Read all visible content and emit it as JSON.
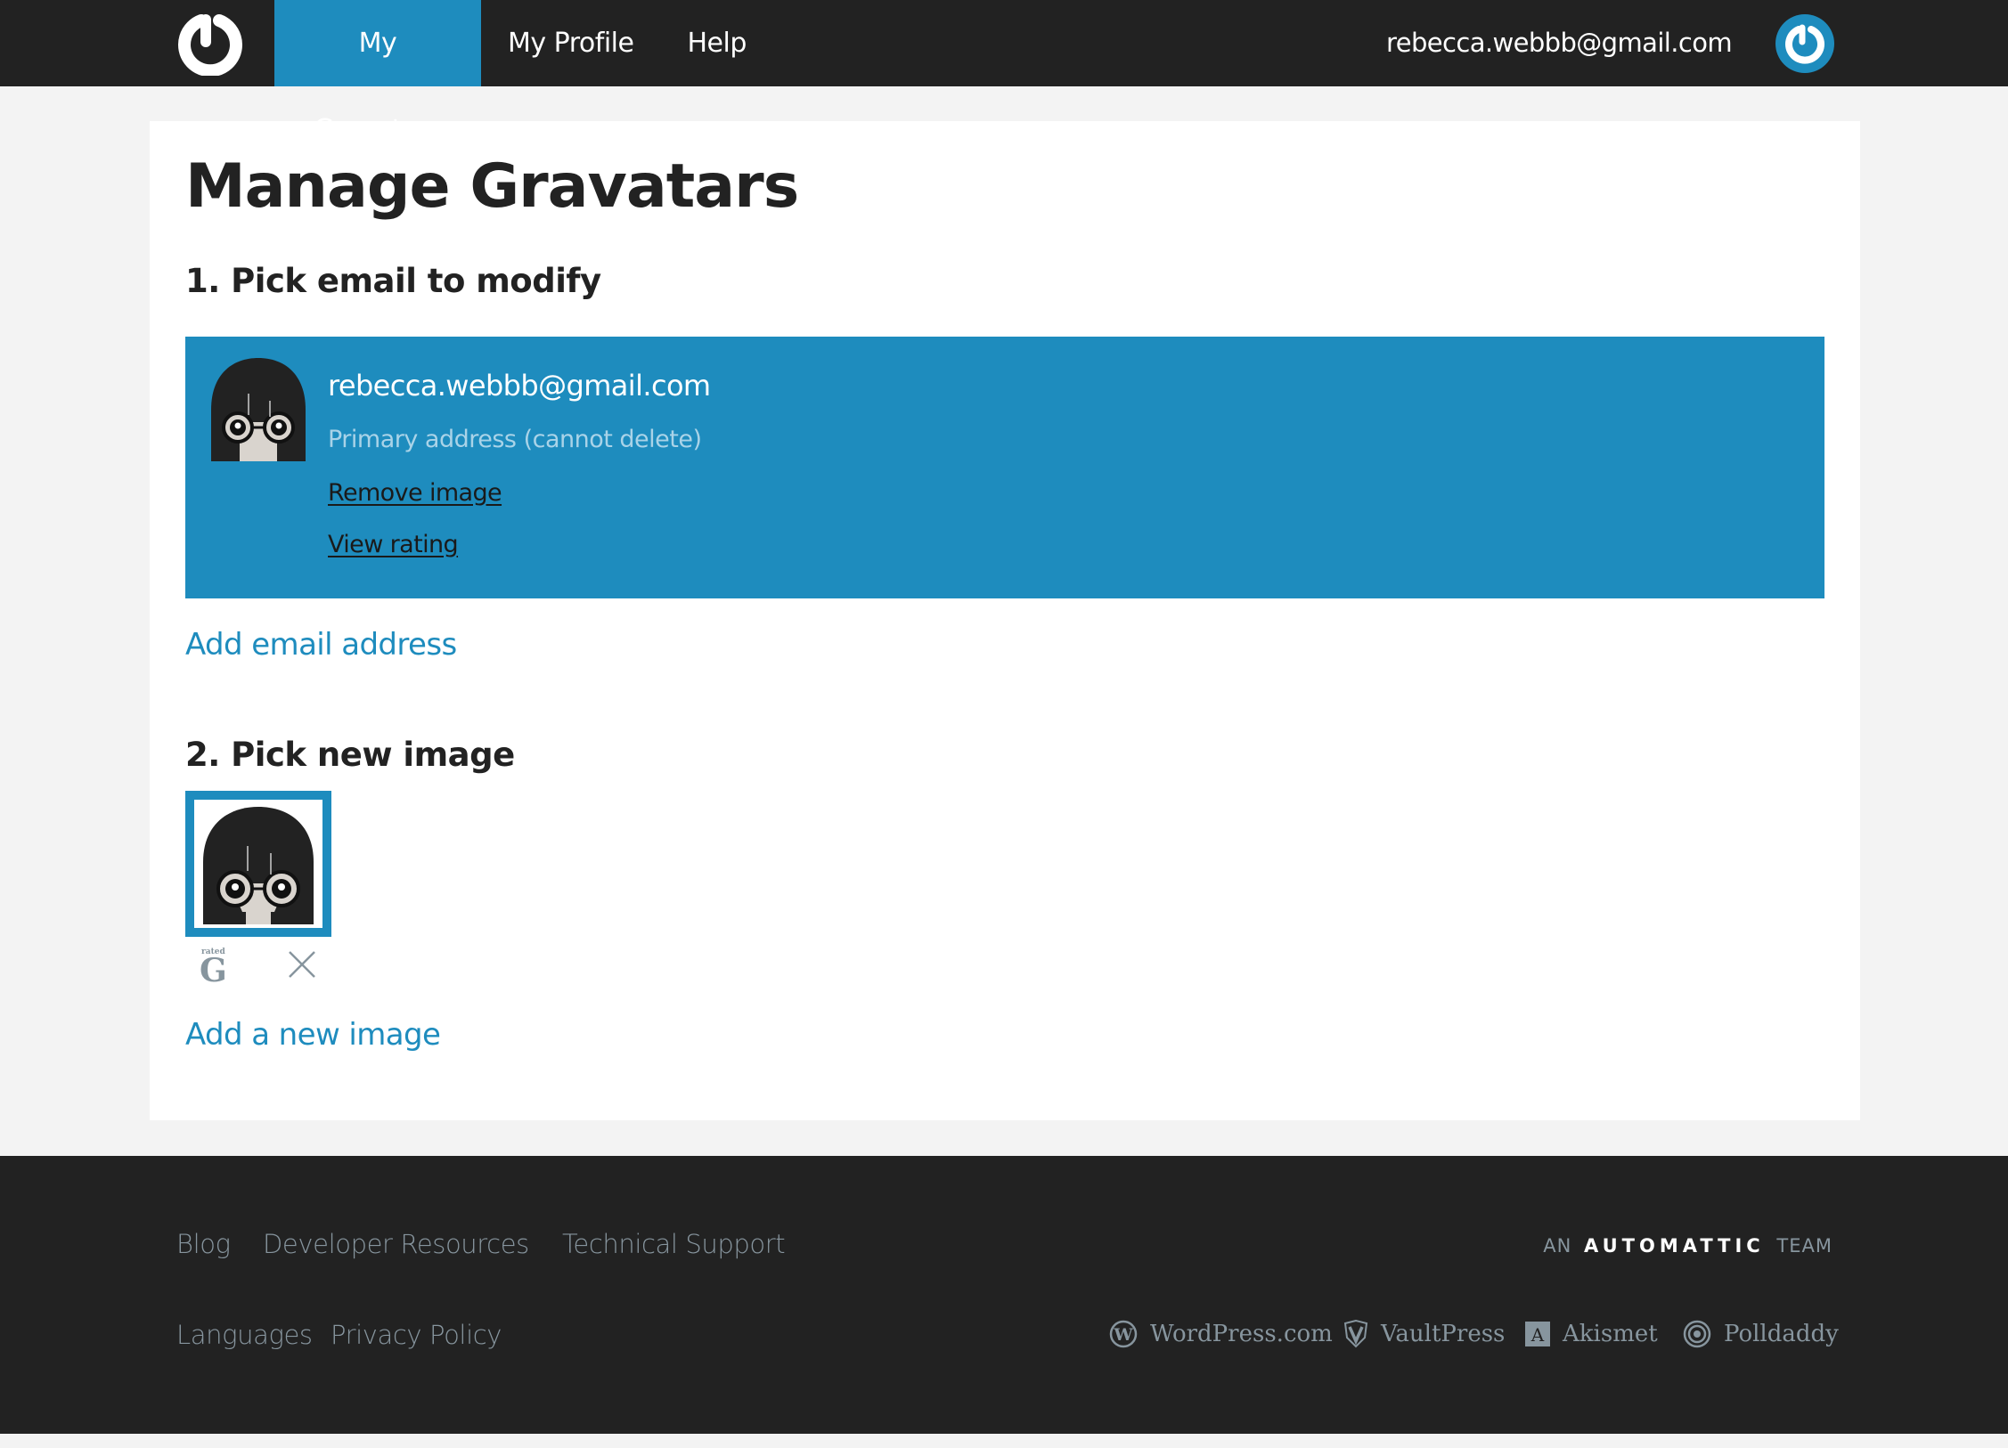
{
  "header": {
    "logo_label": "Gravatar",
    "nav": [
      {
        "label": "My Gravatars",
        "active": true
      },
      {
        "label": "My Profile",
        "active": false
      },
      {
        "label": "Help",
        "active": false
      }
    ],
    "user_email": "rebecca.webbb@gmail.com"
  },
  "main": {
    "title": "Manage Gravatars",
    "step1": {
      "title": "1. Pick email to modify",
      "selected_email": {
        "address": "rebecca.webbb@gmail.com",
        "note": "Primary address (cannot delete)",
        "remove_image_label": "Remove image",
        "view_rating_label": "View rating"
      },
      "add_email_label": "Add email address"
    },
    "step2": {
      "title": "2. Pick new image",
      "images": [
        {
          "rating_prefix": "rated",
          "rating": "G",
          "selected": true
        }
      ],
      "add_image_label": "Add a new image"
    }
  },
  "footer": {
    "links_row1": [
      "Blog",
      "Developer Resources",
      "Technical Support"
    ],
    "links_row2": [
      "Languages",
      "Privacy Policy"
    ],
    "automattic": {
      "prefix": "AN",
      "brand": "AUTOMATTIC",
      "suffix": "TEAM"
    },
    "products": [
      "WordPress.com",
      "VaultPress",
      "Akismet",
      "Polldaddy"
    ]
  },
  "colors": {
    "brand_blue": "#1e8cbe",
    "header_bg": "#222222",
    "page_bg": "#f3f3f3",
    "footer_text": "#87959e"
  }
}
